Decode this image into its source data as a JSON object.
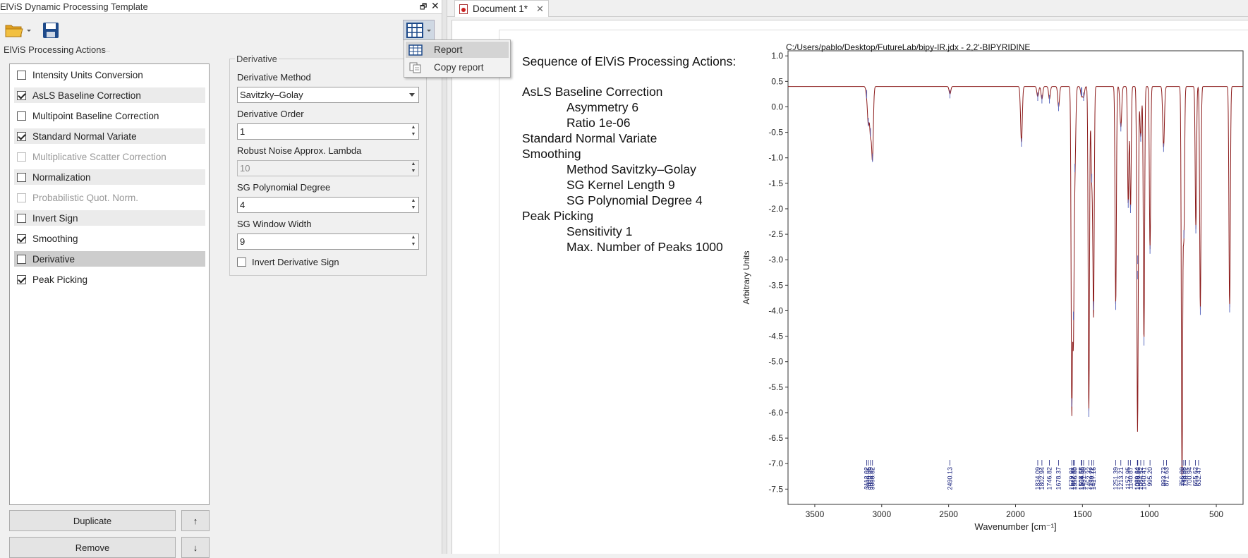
{
  "window": {
    "title": "ElViS Dynamic Processing Template",
    "restore_glyph": "🗗",
    "close_glyph": "✕"
  },
  "toolbar": {
    "open_icon": "folder-icon",
    "save_icon": "floppy-icon",
    "report_icon": "table-icon"
  },
  "actions_panel": {
    "label": "ElViS Processing Actions",
    "items": [
      {
        "label": "Intensity Units Conversion",
        "checked": false,
        "enabled": true
      },
      {
        "label": "AsLS Baseline Correction",
        "checked": true,
        "enabled": true
      },
      {
        "label": "Multipoint Baseline Correction",
        "checked": false,
        "enabled": true
      },
      {
        "label": "Standard Normal Variate",
        "checked": true,
        "enabled": true
      },
      {
        "label": "Multiplicative Scatter Correction",
        "checked": false,
        "enabled": false
      },
      {
        "label": "Normalization",
        "checked": false,
        "enabled": true
      },
      {
        "label": "Probabilistic Quot. Norm.",
        "checked": false,
        "enabled": false
      },
      {
        "label": "Invert Sign",
        "checked": false,
        "enabled": true
      },
      {
        "label": "Smoothing",
        "checked": true,
        "enabled": true
      },
      {
        "label": "Derivative",
        "checked": false,
        "enabled": true,
        "selected": true
      },
      {
        "label": "Peak Picking",
        "checked": true,
        "enabled": true
      }
    ],
    "duplicate_label": "Duplicate",
    "remove_label": "Remove",
    "up_glyph": "↑",
    "down_glyph": "↓"
  },
  "derivative": {
    "group_title": "Derivative",
    "method_label": "Derivative Method",
    "method_value": "Savitzky–Golay",
    "order_label": "Derivative Order",
    "order_value": "1",
    "lambda_label": "Robust Noise Approx. Lambda",
    "lambda_value": "10",
    "poly_label": "SG Polynomial Degree",
    "poly_value": "4",
    "window_label": "SG Window Width",
    "window_value": "9",
    "invert_label": "Invert Derivative Sign"
  },
  "menu": {
    "report": "Report",
    "copy_report": "Copy report"
  },
  "document": {
    "tab_title": "Document 1*",
    "tab_close": "✕"
  },
  "report": {
    "title": "Sequence of ElViS Processing Actions:",
    "lines": [
      {
        "text": "AsLS Baseline Correction",
        "indent": 0
      },
      {
        "text": "Asymmetry 6",
        "indent": 1
      },
      {
        "text": "Ratio 1e-06",
        "indent": 1
      },
      {
        "text": "Standard Normal Variate",
        "indent": 0
      },
      {
        "text": "Smoothing",
        "indent": 0
      },
      {
        "text": "Method Savitzky–Golay",
        "indent": 1
      },
      {
        "text": "SG Kernel Length 9",
        "indent": 1
      },
      {
        "text": "SG Polynomial Degree 4",
        "indent": 1
      },
      {
        "text": "Peak Picking",
        "indent": 0
      },
      {
        "text": "Sensitivity 1",
        "indent": 1
      },
      {
        "text": "Max. Number of Peaks 1000",
        "indent": 1
      }
    ]
  },
  "chart_data": {
    "type": "line",
    "title": "C:/Users/pablo/Desktop/FutureLab/bipy-IR.jdx - 2,2'-BIPYRIDINE",
    "xlabel": "Wavenumber [cm⁻¹]",
    "ylabel": "Arbitrary Units",
    "xlim": [
      3700,
      300
    ],
    "ylim": [
      -7.8,
      1.1
    ],
    "x_reversed": true,
    "xticks": [
      3500,
      3000,
      2500,
      2000,
      1500,
      1000,
      500
    ],
    "yticks": [
      1.0,
      0.5,
      0.0,
      -0.5,
      -1.0,
      -1.5,
      -2.0,
      -2.5,
      -3.0,
      -3.5,
      -4.0,
      -4.5,
      -5.0,
      -5.5,
      -6.0,
      -6.5,
      -7.0,
      -7.5
    ],
    "line_color": "#8b1a1a",
    "peak_color": "#1a237e",
    "baseline": 0.4,
    "peaks": [
      {
        "x": 3112.02,
        "y": 0.25
      },
      {
        "x": 3099.96,
        "y": -0.3
      },
      {
        "x": 3083.89,
        "y": -0.5
      },
      {
        "x": 3068.82,
        "y": -1.0
      },
      {
        "x": 2490.13,
        "y": 0.25
      },
      {
        "x": 1956,
        "y": -0.7
      },
      {
        "x": 1834.09,
        "y": 0.2
      },
      {
        "x": 1802.94,
        "y": 0.15
      },
      {
        "x": 1746.82,
        "y": 0.15
      },
      {
        "x": 1678.37,
        "y": 0.0
      },
      {
        "x": 1579.91,
        "y": -5.8
      },
      {
        "x": 1567.85,
        "y": -4.1
      },
      {
        "x": 1556.8,
        "y": -1.2
      },
      {
        "x": 1508.58,
        "y": 0.3
      },
      {
        "x": 1504.56,
        "y": 0.3
      },
      {
        "x": 1491.5,
        "y": 0.2
      },
      {
        "x": 1452.32,
        "y": -6.0
      },
      {
        "x": 1430.22,
        "y": -1.4
      },
      {
        "x": 1417.16,
        "y": -3.9
      },
      {
        "x": 1251.39,
        "y": -3.9
      },
      {
        "x": 1213.21,
        "y": -0.4
      },
      {
        "x": 1157.95,
        "y": -1.9
      },
      {
        "x": 1140.87,
        "y": -2.0
      },
      {
        "x": 1089.64,
        "y": -3.3
      },
      {
        "x": 1086.62,
        "y": -3.0
      },
      {
        "x": 1064.52,
        "y": -0.6
      },
      {
        "x": 1040.41,
        "y": -4.6
      },
      {
        "x": 995.2,
        "y": -2.8
      },
      {
        "x": 893.73,
        "y": -0.8
      },
      {
        "x": 756.09,
        "y": -7.3
      },
      {
        "x": 742.2,
        "y": -2.5
      },
      {
        "x": 652.8,
        "y": -2.4
      },
      {
        "x": 619.1,
        "y": -4.0
      },
      {
        "x": 400.3,
        "y": -3.95
      }
    ],
    "peak_labels": [
      "3112.02",
      "3099.96",
      "3083.89",
      "3068.82",
      "2490.13",
      "1834.09",
      "1802.94",
      "1746.82",
      "1678.37",
      "1579.91",
      "1567.85",
      "1556.80",
      "1508.58",
      "1504.56",
      "1491.50",
      "1452.32",
      "1430.22",
      "1417.16",
      "1251.39",
      "1213.21",
      "1157.95",
      "1140.87",
      "1089.64",
      "1086.62",
      "1064.52",
      "1040.41",
      "995.20",
      "893.73",
      "871.63",
      "756.09",
      "743.08",
      "730.02",
      "700.94",
      "655.62",
      "632.47"
    ]
  }
}
